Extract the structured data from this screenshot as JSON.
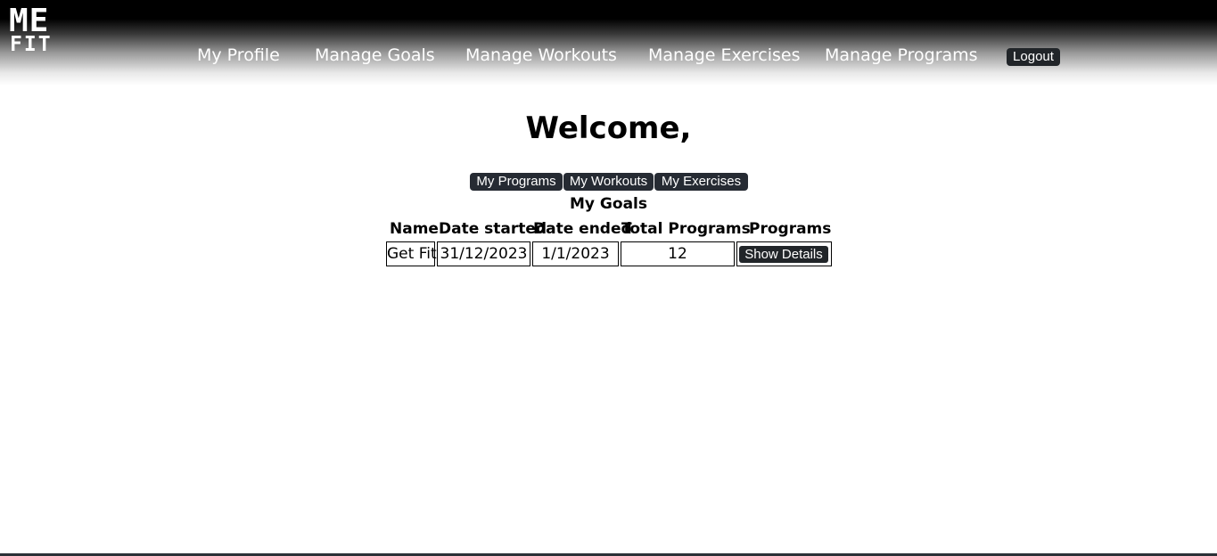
{
  "logo": {
    "line1": "ME",
    "line2": "FIT"
  },
  "nav": {
    "items": [
      "My Profile",
      "Manage Goals",
      "Manage Workouts",
      "Manage Exercises",
      "Manage Programs"
    ],
    "logout": "Logout"
  },
  "main": {
    "welcome": "Welcome,",
    "buttons": [
      "My Programs",
      "My Workouts",
      "My Exercises"
    ],
    "goals_title": "My Goals"
  },
  "table": {
    "headers": [
      "Name",
      "Date started",
      "Date ended",
      "Total Programs",
      "Programs"
    ],
    "rows": [
      {
        "name": "Get Fit",
        "date_started": "31/12/2023",
        "date_ended": "1/1/2023",
        "total_programs": "12",
        "action": "Show Details"
      }
    ]
  }
}
